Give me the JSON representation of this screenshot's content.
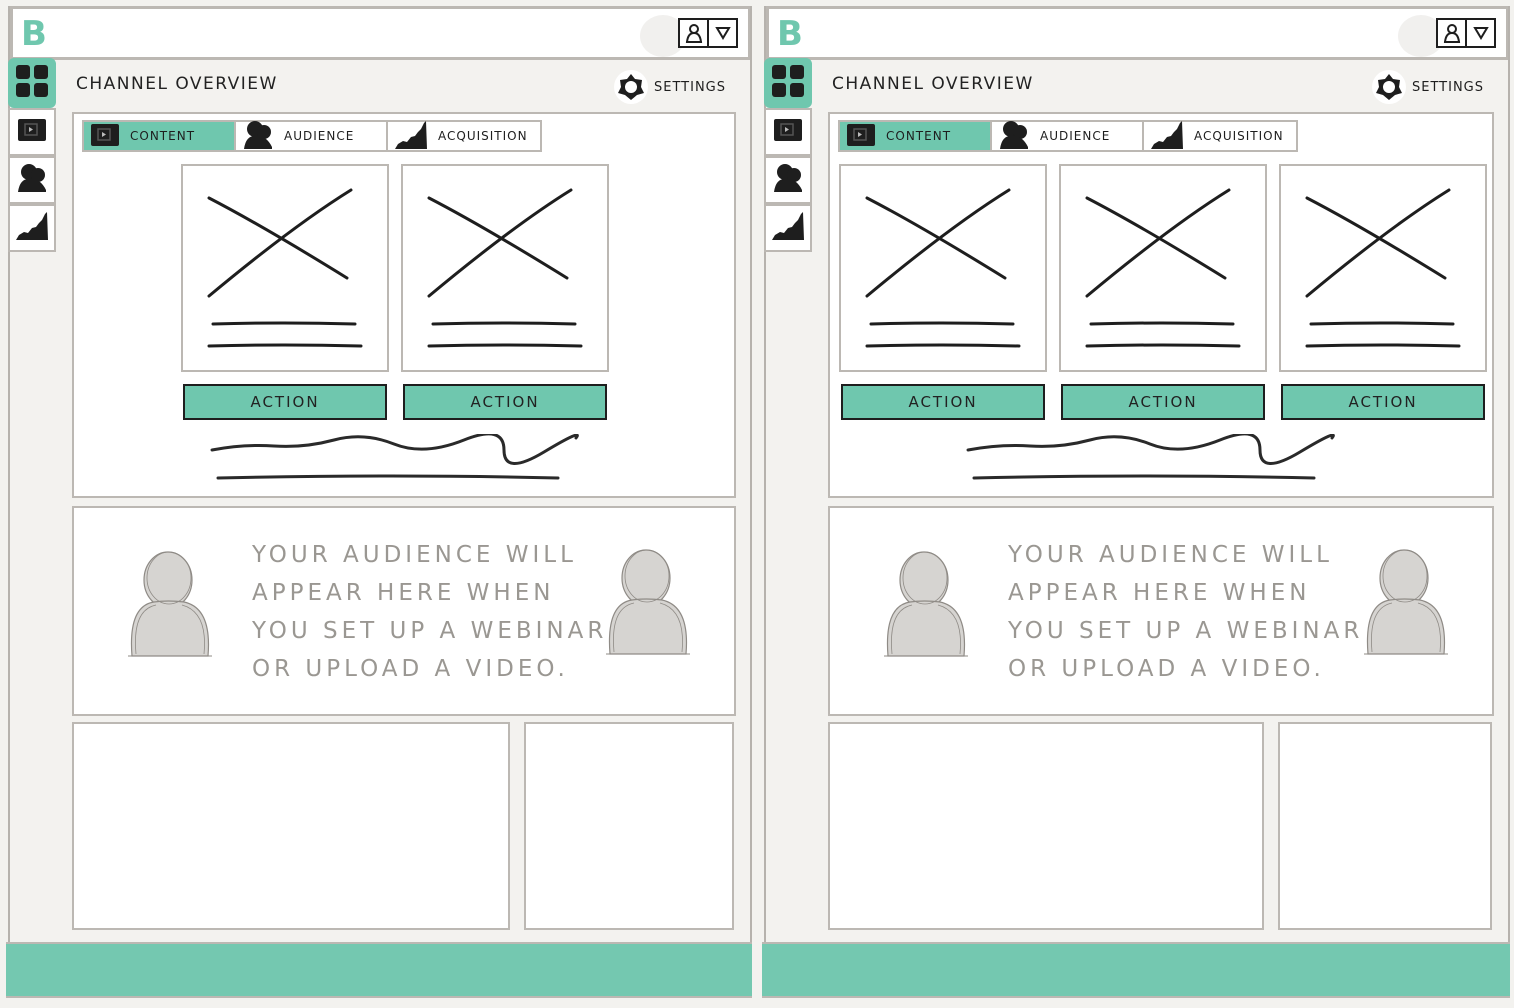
{
  "colors": {
    "accent": "#6fc7ae",
    "footer": "#74c8b0",
    "ink": "#1e1e1e",
    "border": "#bcb8b3",
    "placeholder_text": "#9a9792",
    "placeholder_fill": "#d6d4d1"
  },
  "frames": [
    {
      "header": {
        "logo": "B",
        "user_menu": {
          "icons": [
            "user-icon",
            "caret-down-icon"
          ]
        }
      },
      "sidebar": {
        "items": [
          {
            "icon": "dashboard-grid-icon",
            "active": true
          },
          {
            "icon": "video-icon",
            "active": false
          },
          {
            "icon": "audience-icon",
            "active": false
          },
          {
            "icon": "acquisition-chart-icon",
            "active": false
          }
        ]
      },
      "page_title": "CHANNEL OVERVIEW",
      "settings_label": "SETTINGS",
      "tabs": [
        {
          "label": "CONTENT",
          "icon": "video-icon",
          "active": true
        },
        {
          "label": "AUDIENCE",
          "icon": "audience-icon",
          "active": false
        },
        {
          "label": "ACQUISITION",
          "icon": "acquisition-chart-icon",
          "active": false
        }
      ],
      "cards": [
        {
          "image": "image-placeholder",
          "action_label": "ACTION"
        },
        {
          "image": "image-placeholder",
          "action_label": "ACTION"
        }
      ],
      "audience_message": "YOUR AUDIENCE WILL APPEAR HERE WHEN YOU SET UP A WEBINAR OR UPLOAD A VIDEO."
    },
    {
      "header": {
        "logo": "B",
        "user_menu": {
          "icons": [
            "user-icon",
            "caret-down-icon"
          ]
        }
      },
      "sidebar": {
        "items": [
          {
            "icon": "dashboard-grid-icon",
            "active": true
          },
          {
            "icon": "video-icon",
            "active": false
          },
          {
            "icon": "audience-icon",
            "active": false
          },
          {
            "icon": "acquisition-chart-icon",
            "active": false
          }
        ]
      },
      "page_title": "CHANNEL OVERVIEW",
      "settings_label": "SETTINGS",
      "tabs": [
        {
          "label": "CONTENT",
          "icon": "video-icon",
          "active": true
        },
        {
          "label": "AUDIENCE",
          "icon": "audience-icon",
          "active": false
        },
        {
          "label": "ACQUISITION",
          "icon": "acquisition-chart-icon",
          "active": false
        }
      ],
      "cards": [
        {
          "image": "image-placeholder",
          "action_label": "ACTION"
        },
        {
          "image": "image-placeholder",
          "action_label": "ACTION"
        },
        {
          "image": "image-placeholder",
          "action_label": "ACTION"
        }
      ],
      "audience_message": "YOUR AUDIENCE WILL APPEAR HERE WHEN YOU SET UP A WEBINAR OR UPLOAD A VIDEO."
    }
  ]
}
